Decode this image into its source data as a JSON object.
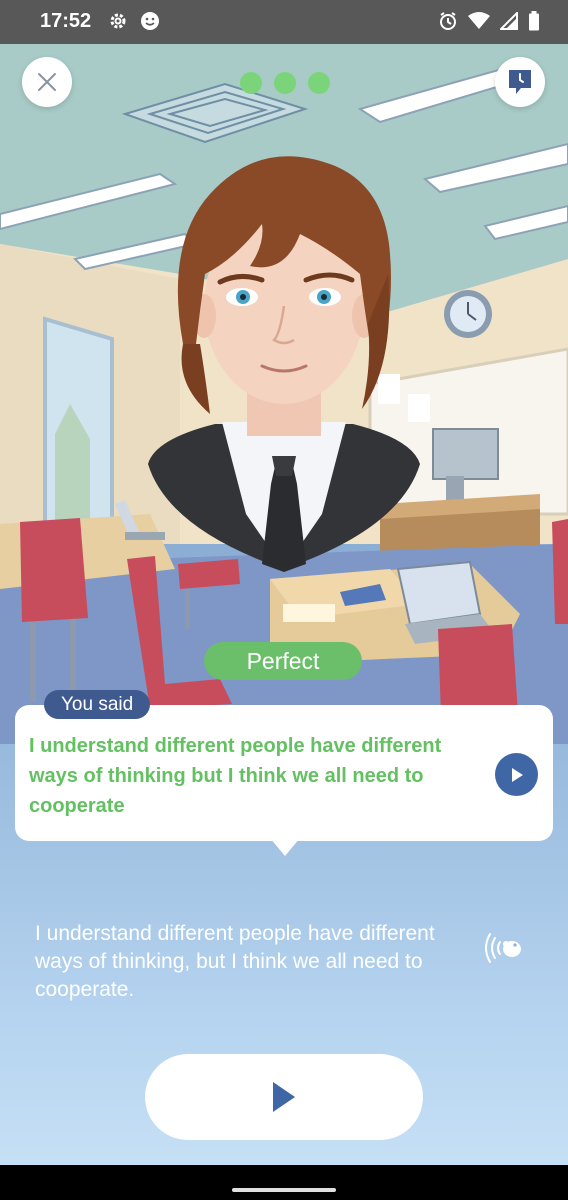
{
  "status_bar": {
    "time": "17:52",
    "left_icons": [
      "settings-icon",
      "smiley-icon"
    ],
    "right_icons": [
      "alarm-icon",
      "wifi-icon",
      "signal-icon",
      "battery-icon"
    ]
  },
  "top_bar": {
    "close_icon": "close-icon",
    "progress_dots": 3,
    "progress_color": "#7bd479",
    "history_icon": "speech-history-icon"
  },
  "result": {
    "label": "Perfect",
    "color": "#6cbf6a"
  },
  "bubble": {
    "badge": "You said",
    "text": "I understand different people have different ways of thinking but I think we all need to cooperate",
    "text_color": "#63c162",
    "play_icon": "play-icon"
  },
  "reference": {
    "text": "I understand different people have different ways of thinking, but I think we all need to cooperate.",
    "listen_icon": "slow-listen-icon"
  },
  "controls": {
    "main_play_icon": "play-icon",
    "accent": "#3f67a6"
  }
}
